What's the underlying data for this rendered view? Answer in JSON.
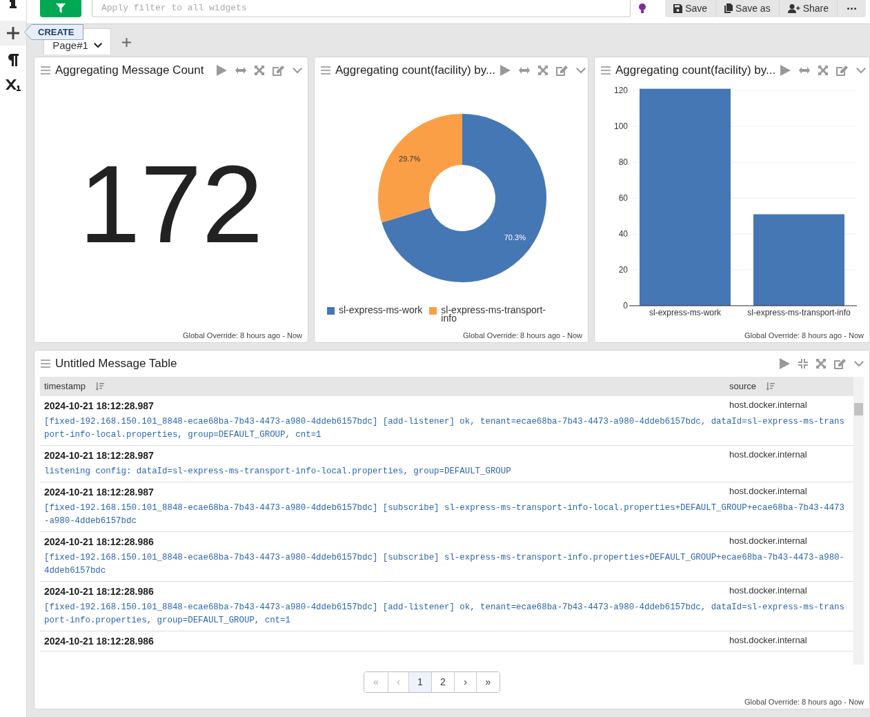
{
  "toolbar": {
    "filter_placeholder": "Apply filter to all widgets",
    "buttons": [
      "Save",
      "Save as",
      "Share"
    ]
  },
  "tooltip": "CREATE",
  "pages": [
    {
      "label": "Page#1",
      "selected": true
    }
  ],
  "widgets": [
    {
      "kind": "number",
      "title": "Aggregating Message Count",
      "value": "172",
      "footer": "Global Override: 8 hours ago - Now"
    },
    {
      "kind": "donut",
      "title": "Aggregating count(facility) by...",
      "footer": "Global Override: 8 hours ago - Now",
      "chart_data": {
        "type": "donut",
        "categories": [
          "sl-express-ms-work",
          "sl-express-ms-transport-info"
        ],
        "values": [
          70.3,
          29.7
        ],
        "value_labels": [
          "70.3%",
          "29.7%"
        ],
        "colors": [
          "#4577b4",
          "#fb9f47"
        ],
        "data_labels": true
      }
    },
    {
      "kind": "bar",
      "title": "Aggregating count(facility) by...",
      "footer": "Global Override: 8 hours ago - Now",
      "chart_data": {
        "type": "bar",
        "categories": [
          "sl-express-ms-work",
          "sl-express-ms-transport-info"
        ],
        "series": [
          {
            "color": "#4577b4",
            "values": [
              121,
              51
            ]
          }
        ],
        "ylim": [
          0,
          122
        ],
        "yticks": [
          0,
          20,
          40,
          60,
          80,
          100,
          120
        ],
        "grid": true
      }
    }
  ],
  "table": {
    "title": "Untitled Message Table",
    "columns": [
      "timestamp",
      "source"
    ],
    "rows": [
      {
        "timestamp": "2024-10-21 18:12:28.987",
        "source": "host.docker.internal",
        "message": "[fixed-192.168.150.101_8848-ecae68ba-7b43-4473-a980-4ddeb6157bdc] [add-listener] ok, tenant=ecae68ba-7b43-4473-a980-4ddeb6157bdc, dataId=sl-express-ms-transport-info-local.properties, group=DEFAULT_GROUP, cnt=1"
      },
      {
        "timestamp": "2024-10-21 18:12:28.987",
        "source": "host.docker.internal",
        "message": "listening config: dataId=sl-express-ms-transport-info-local.properties, group=DEFAULT_GROUP"
      },
      {
        "timestamp": "2024-10-21 18:12:28.987",
        "source": "host.docker.internal",
        "message": "[fixed-192.168.150.101_8848-ecae68ba-7b43-4473-a980-4ddeb6157bdc] [subscribe] sl-express-ms-transport-info-local.properties+DEFAULT_GROUP+ecae68ba-7b43-4473-a980-4ddeb6157bdc"
      },
      {
        "timestamp": "2024-10-21 18:12:28.986",
        "source": "host.docker.internal",
        "message": "[fixed-192.168.150.101_8848-ecae68ba-7b43-4473-a980-4ddeb6157bdc] [subscribe] sl-express-ms-transport-info.properties+DEFAULT_GROUP+ecae68ba-7b43-4473-a980-4ddeb6157bdc"
      },
      {
        "timestamp": "2024-10-21 18:12:28.986",
        "source": "host.docker.internal",
        "message": "[fixed-192.168.150.101_8848-ecae68ba-7b43-4473-a980-4ddeb6157bdc] [add-listener] ok, tenant=ecae68ba-7b43-4473-a980-4ddeb6157bdc, dataId=sl-express-ms-transport-info.properties, group=DEFAULT_GROUP, cnt=1"
      },
      {
        "timestamp": "2024-10-21 18:12:28.986",
        "source": "host.docker.internal"
      }
    ],
    "pagination": [
      {
        "label": "«",
        "selected": false,
        "disabled": true
      },
      {
        "label": "‹",
        "selected": false,
        "disabled": true
      },
      {
        "label": "1",
        "selected": true,
        "disabled": false
      },
      {
        "label": "2",
        "selected": false,
        "disabled": false
      },
      {
        "label": "›",
        "selected": false,
        "disabled": false
      },
      {
        "label": "»",
        "selected": false,
        "disabled": false
      }
    ],
    "footer": "Global Override: 8 hours ago - Now"
  }
}
